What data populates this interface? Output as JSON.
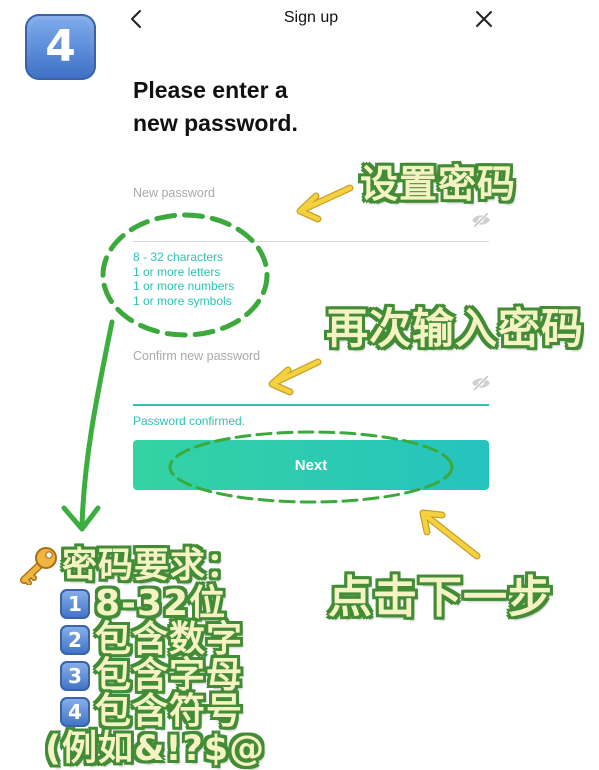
{
  "badge": {
    "number": "4"
  },
  "header": {
    "title": "Sign up"
  },
  "heading": {
    "line1": "Please enter a",
    "line2": "new password."
  },
  "new_password": {
    "label": "New password"
  },
  "requirements": [
    "8 - 32 characters",
    "1 or more letters",
    "1 or more numbers",
    "1 or more symbols"
  ],
  "confirm_password": {
    "label": "Confirm new password"
  },
  "status": {
    "text": "Password confirmed."
  },
  "next_button": {
    "label": "Next"
  },
  "annotations": {
    "set_password": "设置密码",
    "reenter_password": "再次输入密码",
    "click_next": "点击下一步",
    "requirements_title": "密码要求：",
    "requirements_list": [
      {
        "number": "1",
        "text": "8-32位"
      },
      {
        "number": "2",
        "text": "包含数字"
      },
      {
        "number": "3",
        "text": "包含字母"
      },
      {
        "number": "4",
        "text": "包含符号"
      }
    ],
    "example": "(例如&!?$@"
  },
  "icons": {
    "back": "chevron-left-icon",
    "close": "close-icon",
    "visibility_toggle": "eye-off-icon",
    "key": "key-icon",
    "keycap": "keycap-digit-icon"
  },
  "colors": {
    "accent": "#2ec2b3",
    "button_start": "#34d3a3",
    "button_end": "#25c3bf",
    "annotation_fill": "#f5f2c4",
    "annotation_stroke": "#428c36",
    "arrow_green": "#3cae3e",
    "arrow_yellow": "#f4d13f",
    "keycap_blue": "#4a7ccd"
  }
}
